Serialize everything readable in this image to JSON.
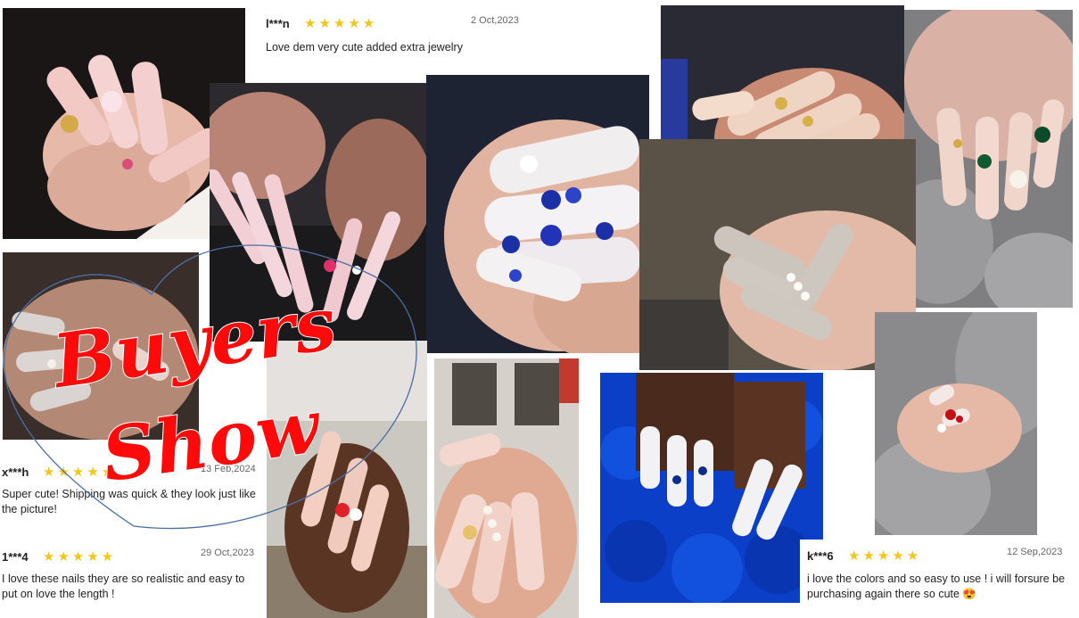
{
  "colors": {
    "star": "#f5c518",
    "title": "#ff0a0a",
    "title_outline": "#ffffff",
    "heart_outline": "#4a6fa5"
  },
  "title": {
    "line1": "Buyers",
    "line2": "Show"
  },
  "reviews": [
    {
      "user": "l***n",
      "stars": "★★★★★",
      "rating": 5,
      "date": "2 Oct,2023",
      "text": "Love dem very cute added extra jewelry"
    },
    {
      "user": "x***h",
      "stars": "★★★★★",
      "rating": 5,
      "date": "13 Feb,2024",
      "text": "Super cute! Shipping was quick & they look just like the picture!"
    },
    {
      "user": "1***4",
      "stars": "★★★★★",
      "rating": 5,
      "date": "29 Oct,2023",
      "text": "I love these nails they are so realistic and easy to put on love the length !"
    },
    {
      "user": "k***6",
      "stars": "★★★★★",
      "rating": 5,
      "date": "12 Sep,2023",
      "text": "i love the colors and so easy to use ! i will forsure be purchasing again there so cute 😍"
    }
  ],
  "photos": [
    {
      "name": "nail-photo-pink-french-gold",
      "theme": "pink french tips with gold charms"
    },
    {
      "name": "nail-photo-long-pink-charms",
      "theme": "long pink tips with charms"
    },
    {
      "name": "nail-photo-blue-rhinestone",
      "theme": "white nails with blue rhinestones"
    },
    {
      "name": "nail-photo-nude-gold-lines",
      "theme": "nude nails with gold accents"
    },
    {
      "name": "nail-photo-emerald-gems",
      "theme": "nude nails with emerald gems"
    },
    {
      "name": "nail-photo-dark-hand-charms",
      "theme": "pink nails on dark background"
    },
    {
      "name": "nail-photo-grey-pearls",
      "theme": "grey nails with pearls"
    },
    {
      "name": "nail-photo-heart-butterfly",
      "theme": "nude nails with heart and butterfly charms"
    },
    {
      "name": "nail-photo-pearl-swirl",
      "theme": "pink nails with pearl swirl"
    },
    {
      "name": "nail-photo-blue-roses",
      "theme": "white nails over blue roses"
    },
    {
      "name": "nail-photo-red-gem-short",
      "theme": "short nails with red gems"
    }
  ]
}
